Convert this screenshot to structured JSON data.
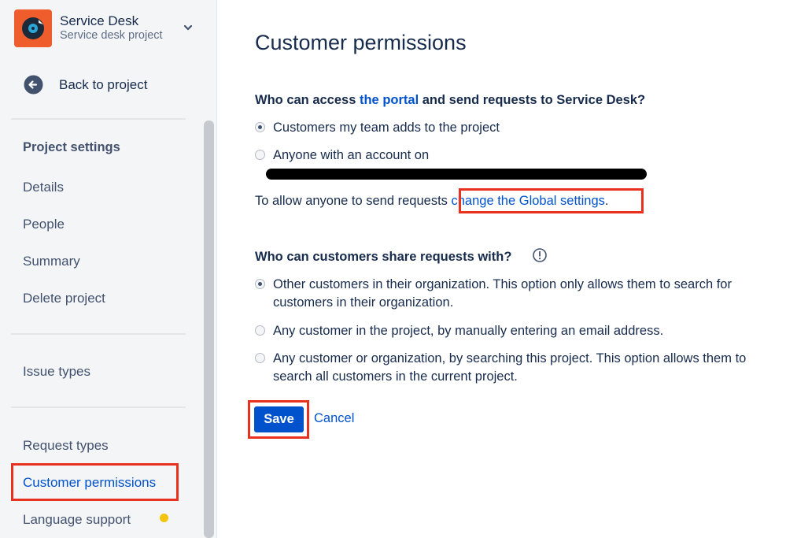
{
  "sidebar": {
    "project_name": "Service Desk",
    "project_sub": "Service desk project",
    "back_label": "Back to project",
    "heading": "Project settings",
    "items": [
      "Details",
      "People",
      "Summary",
      "Delete project",
      "Issue types",
      "Request types",
      "Customer permissions",
      "Language support"
    ]
  },
  "main": {
    "title": "Customer permissions",
    "q1_pre": "Who can access ",
    "q1_link": "the portal",
    "q1_post": " and send requests to Service Desk?",
    "q1_options": [
      "Customers my team adds to the project",
      "Anyone with an account on"
    ],
    "allow_text": "To allow anyone to send requests ",
    "allow_link": "change the Global settings",
    "allow_end": ".",
    "q2": "Who can customers share requests with?",
    "q2_options": [
      "Other customers in their organization. This option only allows them to search for customers in their organization.",
      "Any customer in the project, by manually entering an email address.",
      "Any customer or organization, by searching this project. This option allows them to search all customers in the current project."
    ],
    "save": "Save",
    "cancel": "Cancel"
  },
  "colors": {
    "accent": "#0052cc",
    "highlight": "#e8321f",
    "project_avatar": "#ef5d2c",
    "notice_dot": "#f2c40c"
  }
}
